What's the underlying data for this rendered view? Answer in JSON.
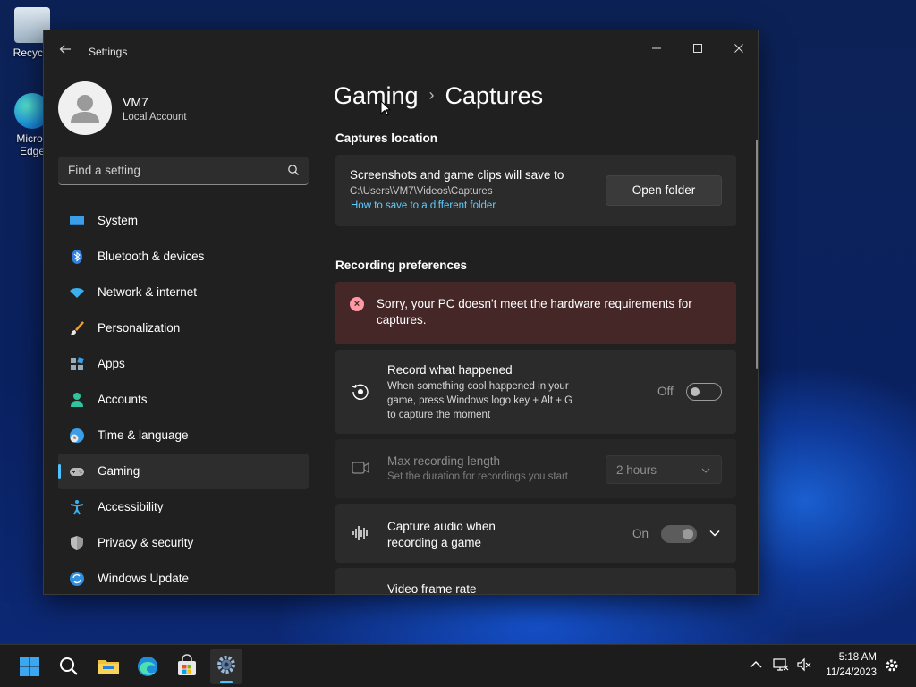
{
  "desktop": {
    "icons": [
      {
        "label": "Recycle"
      },
      {
        "label": "Micros Edge"
      }
    ]
  },
  "window": {
    "title": "Settings",
    "controls": {
      "minimize": "minimize",
      "maximize": "maximize",
      "close": "close"
    }
  },
  "profile": {
    "name": "VM7",
    "account_type": "Local Account"
  },
  "search": {
    "placeholder": "Find a setting"
  },
  "sidebar": {
    "items": [
      {
        "label": "System",
        "icon": "system-icon"
      },
      {
        "label": "Bluetooth & devices",
        "icon": "bluetooth-icon"
      },
      {
        "label": "Network & internet",
        "icon": "wifi-icon"
      },
      {
        "label": "Personalization",
        "icon": "brush-icon"
      },
      {
        "label": "Apps",
        "icon": "apps-icon"
      },
      {
        "label": "Accounts",
        "icon": "accounts-icon"
      },
      {
        "label": "Time & language",
        "icon": "globe-clock-icon"
      },
      {
        "label": "Gaming",
        "icon": "gamepad-icon",
        "active": true
      },
      {
        "label": "Accessibility",
        "icon": "accessibility-icon"
      },
      {
        "label": "Privacy & security",
        "icon": "shield-icon"
      },
      {
        "label": "Windows Update",
        "icon": "update-icon"
      }
    ]
  },
  "breadcrumb": {
    "parent": "Gaming",
    "separator": "›",
    "current": "Captures"
  },
  "captures_location": {
    "section_title": "Captures location",
    "description": "Screenshots and game clips will save to",
    "path": "C:\\Users\\VM7\\Videos\\Captures",
    "link": "How to save to a different folder",
    "button": "Open folder"
  },
  "recording": {
    "section_title": "Recording preferences",
    "error": "Sorry, your PC doesn't meet the hardware requirements for captures.",
    "record_what_happened": {
      "title": "Record what happened",
      "description": "When something cool happened in your game, press Windows logo key + Alt + G to capture the moment",
      "state_label": "Off",
      "state": false
    },
    "max_length": {
      "title": "Max recording length",
      "description": "Set the duration for recordings you start",
      "value": "2 hours"
    },
    "capture_audio": {
      "title": "Capture audio when recording a game",
      "state_label": "On",
      "state": true
    },
    "frame_rate": {
      "title": "Video frame rate"
    }
  },
  "taskbar": {
    "time": "5:18 AM",
    "date": "11/24/2023"
  },
  "colors": {
    "accent": "#4cc2ff",
    "error_bg": "#442726",
    "window_bg": "#202020"
  }
}
